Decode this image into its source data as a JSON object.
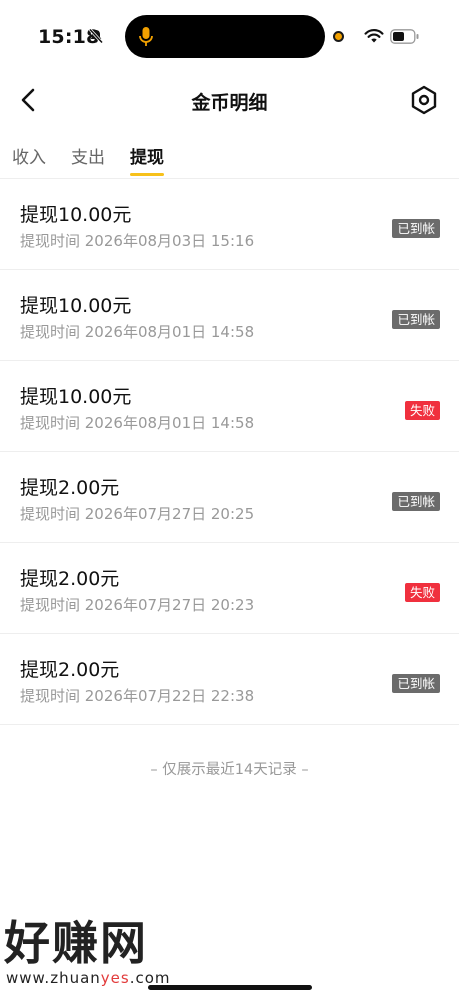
{
  "status_bar": {
    "time": "15:18"
  },
  "header": {
    "title": "金币明细"
  },
  "tabs": [
    {
      "label": "收入",
      "active": false
    },
    {
      "label": "支出",
      "active": false
    },
    {
      "label": "提现",
      "active": true
    }
  ],
  "records": [
    {
      "amount": "提现10.00元",
      "time": "提现时间 2026年08月03日 15:16",
      "status": "已到帐",
      "status_color": "#6b6b6b"
    },
    {
      "amount": "提现10.00元",
      "time": "提现时间 2026年08月01日 14:58",
      "status": "已到帐",
      "status_color": "#6b6b6b"
    },
    {
      "amount": "提现10.00元",
      "time": "提现时间 2026年08月01日 14:58",
      "status": "失败",
      "status_color": "#f0303e"
    },
    {
      "amount": "提现2.00元",
      "time": "提现时间 2026年07月27日 20:25",
      "status": "已到帐",
      "status_color": "#6b6b6b"
    },
    {
      "amount": "提现2.00元",
      "time": "提现时间 2026年07月27日 20:23",
      "status": "失败",
      "status_color": "#f0303e"
    },
    {
      "amount": "提现2.00元",
      "time": "提现时间 2026年07月22日 22:38",
      "status": "已到帐",
      "status_color": "#6b6b6b"
    }
  ],
  "footer_note": "– 仅展示最近14天记录 –",
  "watermark": {
    "title": "好赚网",
    "url_prefix": "www.zhuan",
    "url_accent": "yes",
    "url_suffix": ".com"
  },
  "colors": {
    "tab_indicator": "#f7c11a",
    "fail": "#f0303e",
    "success": "#6b6b6b"
  }
}
